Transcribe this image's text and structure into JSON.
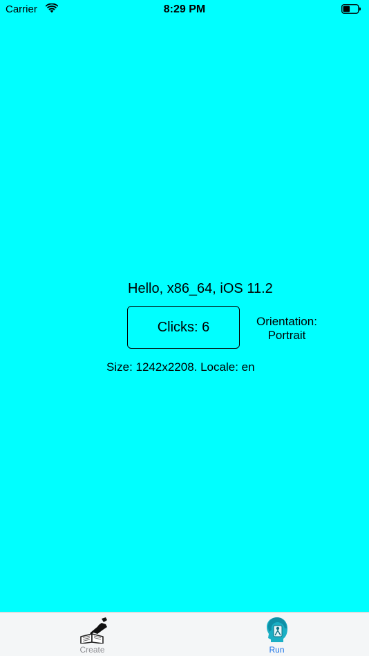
{
  "status_bar": {
    "carrier": "Carrier",
    "time": "8:29 PM"
  },
  "main": {
    "hello_text": "Hello, x86_64, iOS 11.2",
    "clicks_button_label": "Clicks: 6",
    "orientation_text": "Orientation:\nPortrait",
    "orientation_line1": "Orientation:",
    "orientation_line2": "Portrait",
    "size_locale_text": "Size: 1242x2208. Locale: en"
  },
  "tab_bar": {
    "tabs": [
      {
        "label": "Create",
        "icon": "book-pen-icon",
        "selected": false
      },
      {
        "label": "Run",
        "icon": "person-run-icon",
        "selected": true
      }
    ]
  },
  "colors": {
    "background": "#00FFFF",
    "tab_selected": "#1A73E8",
    "tab_unselected": "#8E8E93",
    "tab_bar_bg": "#F4F6F7"
  }
}
